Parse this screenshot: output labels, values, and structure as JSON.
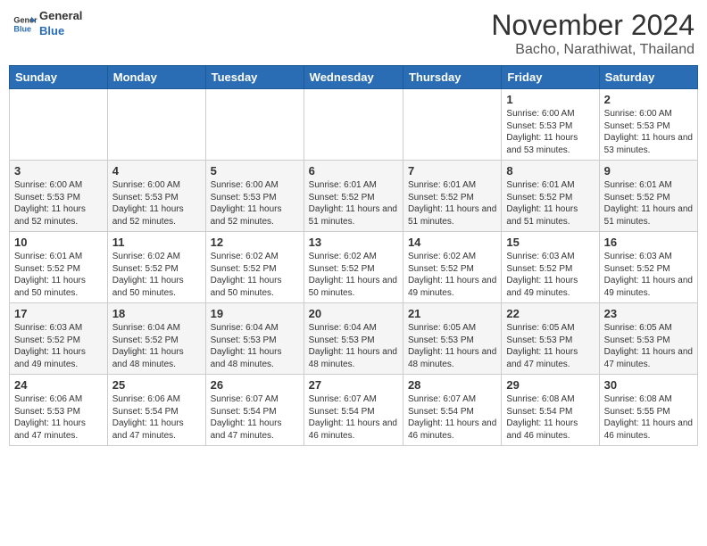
{
  "logo": {
    "line1": "General",
    "line2": "Blue"
  },
  "title": "November 2024",
  "location": "Bacho, Narathiwat, Thailand",
  "weekdays": [
    "Sunday",
    "Monday",
    "Tuesday",
    "Wednesday",
    "Thursday",
    "Friday",
    "Saturday"
  ],
  "weeks": [
    [
      {
        "day": "",
        "info": ""
      },
      {
        "day": "",
        "info": ""
      },
      {
        "day": "",
        "info": ""
      },
      {
        "day": "",
        "info": ""
      },
      {
        "day": "",
        "info": ""
      },
      {
        "day": "1",
        "info": "Sunrise: 6:00 AM\nSunset: 5:53 PM\nDaylight: 11 hours and 53 minutes."
      },
      {
        "day": "2",
        "info": "Sunrise: 6:00 AM\nSunset: 5:53 PM\nDaylight: 11 hours and 53 minutes."
      }
    ],
    [
      {
        "day": "3",
        "info": "Sunrise: 6:00 AM\nSunset: 5:53 PM\nDaylight: 11 hours and 52 minutes."
      },
      {
        "day": "4",
        "info": "Sunrise: 6:00 AM\nSunset: 5:53 PM\nDaylight: 11 hours and 52 minutes."
      },
      {
        "day": "5",
        "info": "Sunrise: 6:00 AM\nSunset: 5:53 PM\nDaylight: 11 hours and 52 minutes."
      },
      {
        "day": "6",
        "info": "Sunrise: 6:01 AM\nSunset: 5:52 PM\nDaylight: 11 hours and 51 minutes."
      },
      {
        "day": "7",
        "info": "Sunrise: 6:01 AM\nSunset: 5:52 PM\nDaylight: 11 hours and 51 minutes."
      },
      {
        "day": "8",
        "info": "Sunrise: 6:01 AM\nSunset: 5:52 PM\nDaylight: 11 hours and 51 minutes."
      },
      {
        "day": "9",
        "info": "Sunrise: 6:01 AM\nSunset: 5:52 PM\nDaylight: 11 hours and 51 minutes."
      }
    ],
    [
      {
        "day": "10",
        "info": "Sunrise: 6:01 AM\nSunset: 5:52 PM\nDaylight: 11 hours and 50 minutes."
      },
      {
        "day": "11",
        "info": "Sunrise: 6:02 AM\nSunset: 5:52 PM\nDaylight: 11 hours and 50 minutes."
      },
      {
        "day": "12",
        "info": "Sunrise: 6:02 AM\nSunset: 5:52 PM\nDaylight: 11 hours and 50 minutes."
      },
      {
        "day": "13",
        "info": "Sunrise: 6:02 AM\nSunset: 5:52 PM\nDaylight: 11 hours and 50 minutes."
      },
      {
        "day": "14",
        "info": "Sunrise: 6:02 AM\nSunset: 5:52 PM\nDaylight: 11 hours and 49 minutes."
      },
      {
        "day": "15",
        "info": "Sunrise: 6:03 AM\nSunset: 5:52 PM\nDaylight: 11 hours and 49 minutes."
      },
      {
        "day": "16",
        "info": "Sunrise: 6:03 AM\nSunset: 5:52 PM\nDaylight: 11 hours and 49 minutes."
      }
    ],
    [
      {
        "day": "17",
        "info": "Sunrise: 6:03 AM\nSunset: 5:52 PM\nDaylight: 11 hours and 49 minutes."
      },
      {
        "day": "18",
        "info": "Sunrise: 6:04 AM\nSunset: 5:52 PM\nDaylight: 11 hours and 48 minutes."
      },
      {
        "day": "19",
        "info": "Sunrise: 6:04 AM\nSunset: 5:53 PM\nDaylight: 11 hours and 48 minutes."
      },
      {
        "day": "20",
        "info": "Sunrise: 6:04 AM\nSunset: 5:53 PM\nDaylight: 11 hours and 48 minutes."
      },
      {
        "day": "21",
        "info": "Sunrise: 6:05 AM\nSunset: 5:53 PM\nDaylight: 11 hours and 48 minutes."
      },
      {
        "day": "22",
        "info": "Sunrise: 6:05 AM\nSunset: 5:53 PM\nDaylight: 11 hours and 47 minutes."
      },
      {
        "day": "23",
        "info": "Sunrise: 6:05 AM\nSunset: 5:53 PM\nDaylight: 11 hours and 47 minutes."
      }
    ],
    [
      {
        "day": "24",
        "info": "Sunrise: 6:06 AM\nSunset: 5:53 PM\nDaylight: 11 hours and 47 minutes."
      },
      {
        "day": "25",
        "info": "Sunrise: 6:06 AM\nSunset: 5:54 PM\nDaylight: 11 hours and 47 minutes."
      },
      {
        "day": "26",
        "info": "Sunrise: 6:07 AM\nSunset: 5:54 PM\nDaylight: 11 hours and 47 minutes."
      },
      {
        "day": "27",
        "info": "Sunrise: 6:07 AM\nSunset: 5:54 PM\nDaylight: 11 hours and 46 minutes."
      },
      {
        "day": "28",
        "info": "Sunrise: 6:07 AM\nSunset: 5:54 PM\nDaylight: 11 hours and 46 minutes."
      },
      {
        "day": "29",
        "info": "Sunrise: 6:08 AM\nSunset: 5:54 PM\nDaylight: 11 hours and 46 minutes."
      },
      {
        "day": "30",
        "info": "Sunrise: 6:08 AM\nSunset: 5:55 PM\nDaylight: 11 hours and 46 minutes."
      }
    ]
  ]
}
